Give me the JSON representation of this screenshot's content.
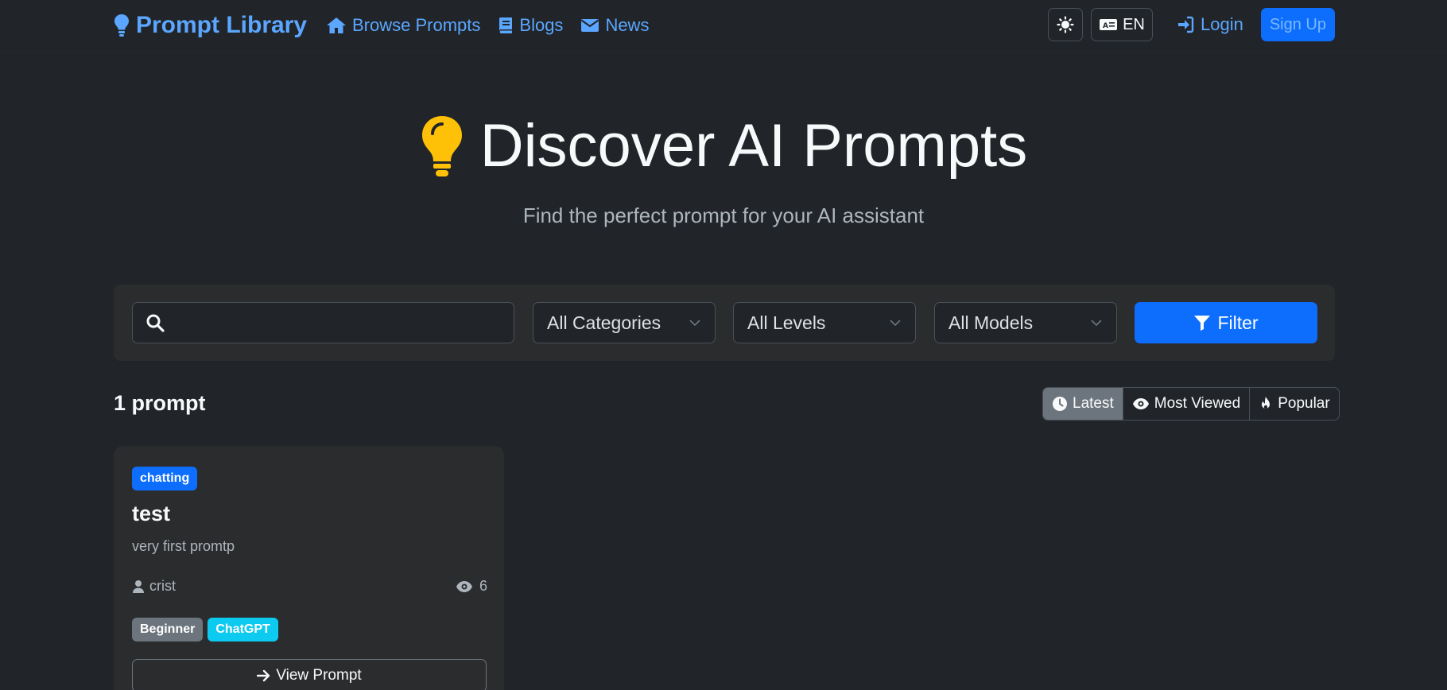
{
  "navbar": {
    "brand": "Prompt Library",
    "links": [
      {
        "label": "Browse Prompts",
        "icon": "home-icon"
      },
      {
        "label": "Blogs",
        "icon": "book-icon"
      },
      {
        "label": "News",
        "icon": "envelope-icon"
      }
    ],
    "language": "EN",
    "login": "Login",
    "signup": "Sign Up"
  },
  "hero": {
    "title": "Discover AI Prompts",
    "subtitle": "Find the perfect prompt for your AI assistant"
  },
  "filters": {
    "search_value": "",
    "category": "All Categories",
    "level": "All Levels",
    "model": "All Models",
    "filter_button": "Filter"
  },
  "results": {
    "count_label": "1 prompt",
    "sort_options": [
      {
        "label": "Latest",
        "active": true
      },
      {
        "label": "Most Viewed",
        "active": false
      },
      {
        "label": "Popular",
        "active": false
      }
    ]
  },
  "prompts": [
    {
      "category": "chatting",
      "title": "test",
      "description": "very first promtp",
      "author": "crist",
      "views": "6",
      "level": "Beginner",
      "model": "ChatGPT",
      "action": "View Prompt"
    }
  ],
  "colors": {
    "background": "#212529",
    "panel": "#2b2c2e",
    "accent": "#0d6efd",
    "link": "#5ba6ff",
    "bulb": "#ffc107",
    "model_badge": "#0dcaf0",
    "level_badge": "#6c757d"
  }
}
